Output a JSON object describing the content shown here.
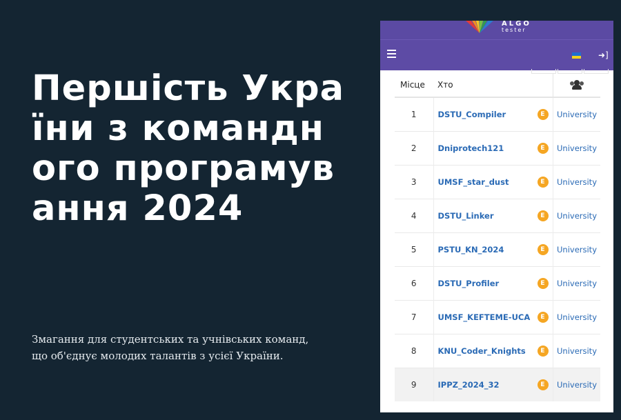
{
  "hero": {
    "title": "Першість України з командного програмування 2024",
    "subtitle": "Змагання для студентських та учнівських команд, що об'єднує молодих талантів з усієї України."
  },
  "app": {
    "logo_line1": "ALGO",
    "logo_line2": "tester",
    "menu_icon": "hamburger-icon",
    "language_icon": "ukraine-flag-icon",
    "login_icon": "sign-in-icon"
  },
  "table": {
    "columns": {
      "place": "Місце",
      "who": "Хто",
      "team_icon": "users-icon"
    },
    "rows": [
      {
        "place": "1",
        "name": "DSTU_Compiler",
        "badge": "E",
        "category": "University"
      },
      {
        "place": "2",
        "name": "Dniprotech121",
        "badge": "E",
        "category": "University"
      },
      {
        "place": "3",
        "name": "UMSF_star_dust",
        "badge": "E",
        "category": "University"
      },
      {
        "place": "4",
        "name": "DSTU_Linker",
        "badge": "E",
        "category": "University"
      },
      {
        "place": "5",
        "name": "PSTU_KN_2024",
        "badge": "E",
        "category": "University"
      },
      {
        "place": "6",
        "name": "DSTU_Profiler",
        "badge": "E",
        "category": "University"
      },
      {
        "place": "7",
        "name": "UMSF_KEFTEME-UCA",
        "badge": "E",
        "category": "University"
      },
      {
        "place": "8",
        "name": "KNU_Coder_Knights",
        "badge": "E",
        "category": "University"
      },
      {
        "place": "9",
        "name": "IPPZ_2024_32",
        "badge": "E",
        "category": "University"
      }
    ]
  },
  "colors": {
    "background": "#142532",
    "navbar": "#5d4ba5",
    "link": "#2a6ab5",
    "badge": "#f5a623"
  }
}
